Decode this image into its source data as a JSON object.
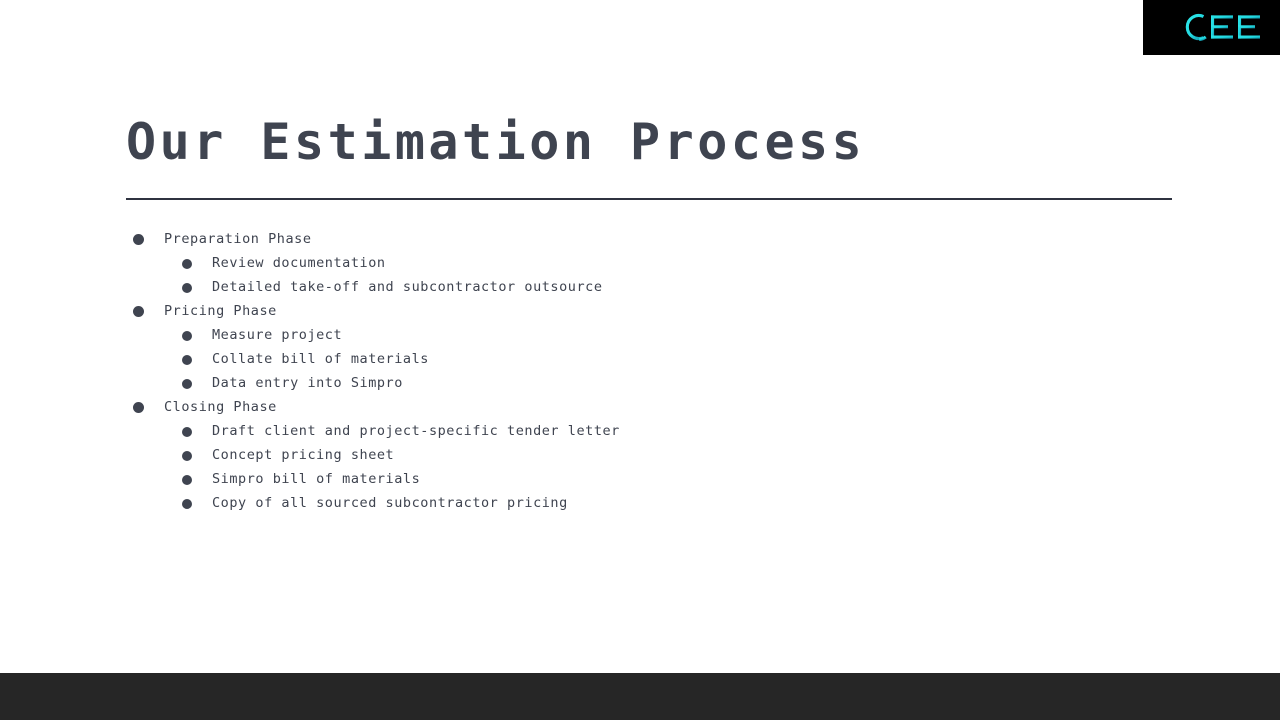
{
  "slide": {
    "title": "Our Estimation Process",
    "background_color": "#ffffff",
    "title_color": "#3f4450",
    "divider_color": "#2f3340"
  },
  "logo": {
    "text": "CEE",
    "plate_color": "#000000",
    "mark_color": "#22d8e0",
    "mark_color_secondary": "#1aa9b8"
  },
  "content": {
    "items": [
      {
        "level": 1,
        "label": "Preparation Phase"
      },
      {
        "level": 2,
        "label": "Review documentation"
      },
      {
        "level": 2,
        "label": "Detailed take-off and subcontractor outsource"
      },
      {
        "level": 1,
        "label": "Pricing Phase"
      },
      {
        "level": 2,
        "label": "Measure project"
      },
      {
        "level": 2,
        "label": "Collate bill of materials"
      },
      {
        "level": 2,
        "label": "Data entry into Simpro"
      },
      {
        "level": 1,
        "label": "Closing Phase"
      },
      {
        "level": 2,
        "label": "Draft client and project-specific tender letter"
      },
      {
        "level": 2,
        "label": "Concept pricing sheet"
      },
      {
        "level": 2,
        "label": "Simpro bill of materials"
      },
      {
        "level": 2,
        "label": "Copy of all sourced subcontractor pricing"
      }
    ]
  },
  "footer": {
    "bar_color": "#262626"
  }
}
